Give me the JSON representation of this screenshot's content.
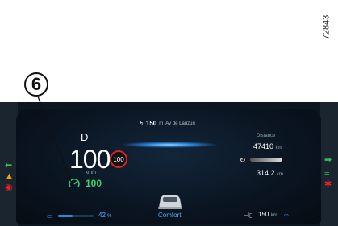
{
  "figure_ref": "72843",
  "callout": {
    "number": "6"
  },
  "cluster": {
    "gear": "D",
    "speed": "100",
    "speed_unit": "km/h",
    "speed_limit": "100",
    "cruise_speed": "100",
    "navigation": {
      "distance": "150",
      "unit": "m",
      "street": "Av de Lauzun"
    },
    "distance_label": "Distance",
    "odometer": "47410",
    "odometer_unit": "km",
    "trip": "314.2",
    "trip_unit": "km",
    "drive_mode": "Comfort",
    "battery": {
      "level_percent": 42,
      "label": "42",
      "unit": "%"
    },
    "range": "150",
    "range_unit": "km",
    "colors": {
      "cruise": "#3cd36a",
      "speed_limit_ring": "#d22222",
      "accent": "#2a8ae0"
    }
  },
  "side_indicators": {
    "left": [
      "arrow-left-icon",
      "warning-icon",
      "brake-icon"
    ],
    "right": [
      "arrow-right-icon",
      "lights-icon",
      "seatbelt-icon"
    ]
  }
}
